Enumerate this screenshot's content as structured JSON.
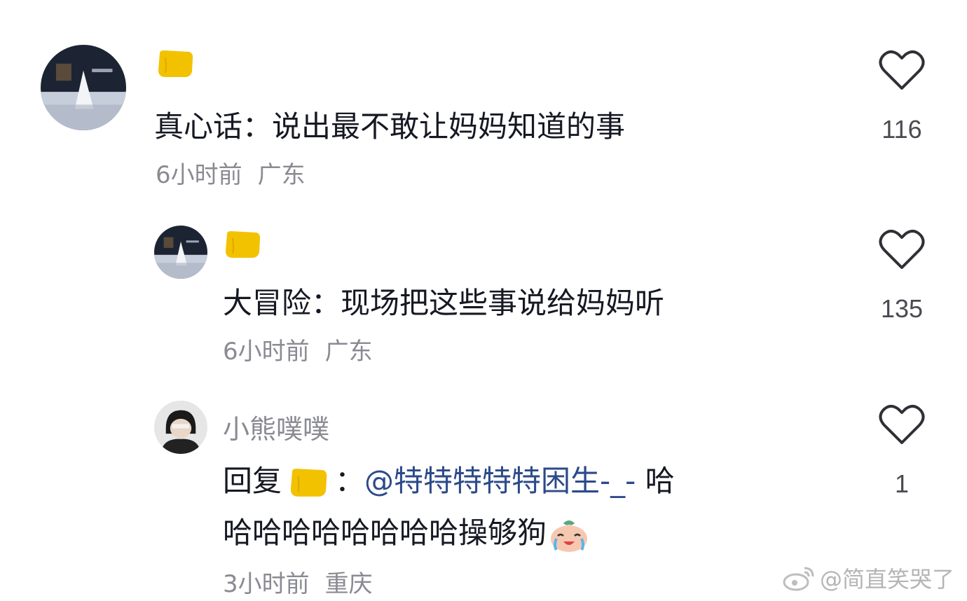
{
  "comments": [
    {
      "avatar_icon": "avatar-scene-icon",
      "name_emoji": "yellow-fist-emoji",
      "text": "真心话：说出最不敢让妈妈知道的事",
      "time": "6小时前",
      "location": "广东",
      "likes": "116"
    },
    {
      "avatar_icon": "avatar-scene-icon",
      "name_emoji": "yellow-fist-emoji",
      "text": "大冒险：现场把这些事说给妈妈听",
      "time": "6小时前",
      "location": "广东",
      "likes": "135"
    },
    {
      "avatar_icon": "avatar-person-icon",
      "username": "小熊噗噗",
      "reply_prefix": "回复",
      "reply_colon": "：",
      "mention": "@特特特特特困生-_-",
      "text_line1_tail": " 哈",
      "text_line2": "哈哈哈哈哈哈哈哈操够狗",
      "trailing_emoji": "crying-laughing-face-emoji",
      "time": "3小时前",
      "location": "重庆",
      "likes": "1"
    }
  ],
  "watermark": {
    "icon": "weibo-logo-icon",
    "text": "@简直笑哭了"
  },
  "colors": {
    "text": "#161823",
    "secondary": "#8a8a93",
    "mention": "#2c4a8a",
    "fist_emoji": "#f2c200"
  }
}
